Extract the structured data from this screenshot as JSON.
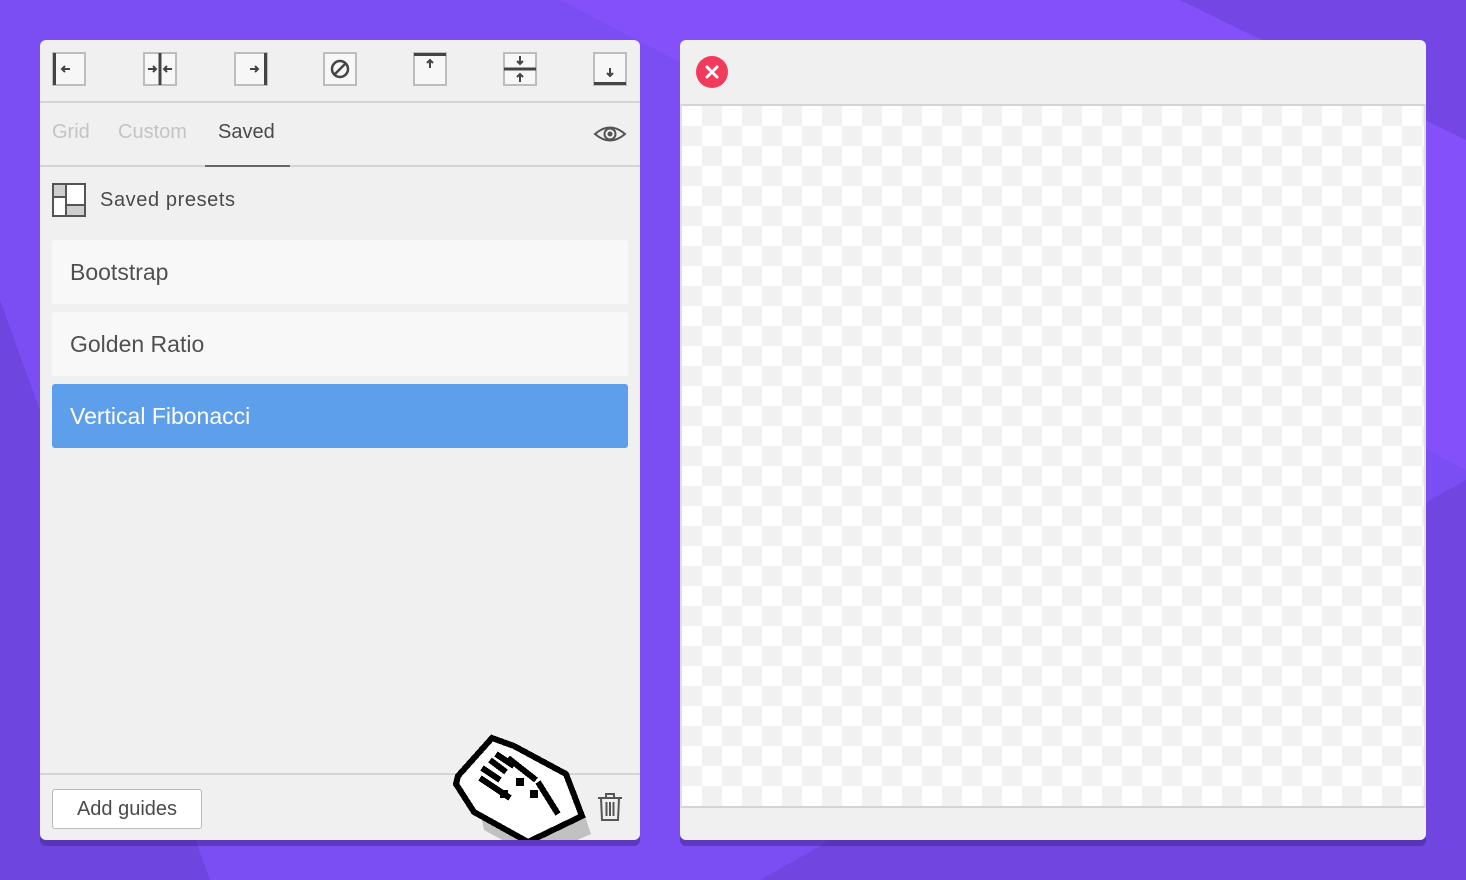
{
  "toolbar": {
    "buttons": [
      {
        "icon": "align-left-icon"
      },
      {
        "icon": "align-center-vertical-icon"
      },
      {
        "icon": "align-right-icon"
      },
      {
        "icon": "clear-guides-icon"
      },
      {
        "icon": "align-top-icon"
      },
      {
        "icon": "align-middle-horizontal-icon"
      },
      {
        "icon": "align-bottom-icon"
      }
    ]
  },
  "tabs": [
    {
      "label": "Grid",
      "active": false
    },
    {
      "label": "Custom",
      "active": false
    },
    {
      "label": "Saved",
      "active": true
    }
  ],
  "visibility_icon": "eye-icon",
  "section": {
    "icon": "layout-icon",
    "title": "Saved presets"
  },
  "presets": [
    {
      "label": "Bootstrap",
      "selected": false
    },
    {
      "label": "Golden Ratio",
      "selected": false
    },
    {
      "label": "Vertical Fibonacci",
      "selected": true
    }
  ],
  "footer": {
    "add_button_label": "Add guides",
    "edit_icon": "pencil-edit-icon",
    "delete_icon": "trash-icon"
  },
  "preview": {
    "close_icon": "close-icon"
  },
  "colors": {
    "background": "#7a4ef3",
    "selected": "#5e9fec",
    "close": "#f03b5c",
    "panel": "#f0f0f0"
  }
}
